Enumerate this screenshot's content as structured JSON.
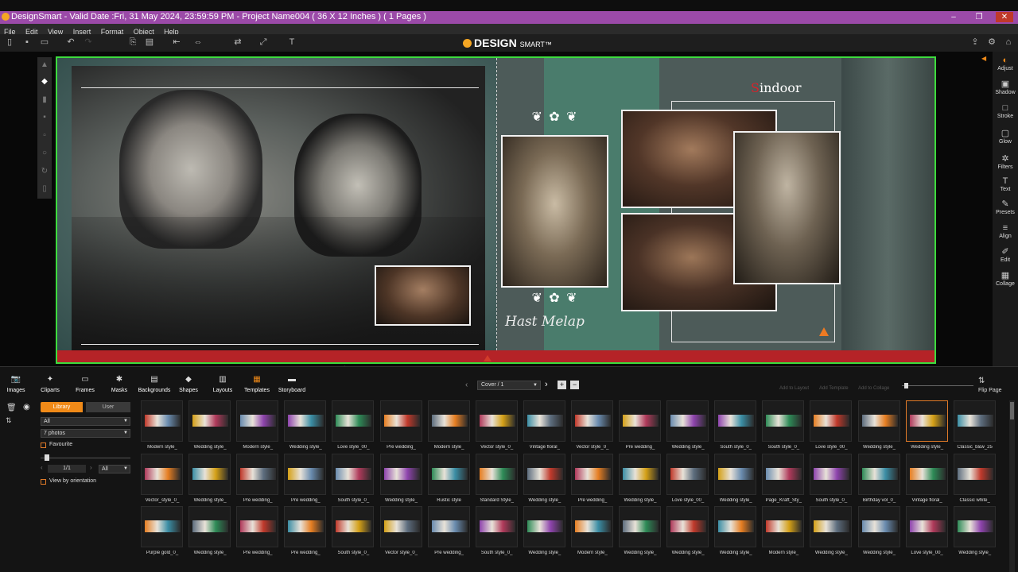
{
  "window": {
    "title": "DesignSmart - Valid Date :Fri, 31 May 2024, 23:59:59 PM - Project Name004 ( 36 X 12 Inches ) ( 1 Pages )",
    "controls": [
      "–",
      "❐",
      "✕"
    ]
  },
  "menu": [
    "File",
    "Edit",
    "View",
    "Insert",
    "Format",
    "Object",
    "Help"
  ],
  "logo": {
    "main": "DESIGN",
    "sub": "SMART™"
  },
  "canvas": {
    "heading": "Sindoor",
    "heading_initial": "S",
    "heading_rest": "indoor",
    "script_text": "Hast Melap",
    "ornament": "❦ ✿ ❦"
  },
  "right_panel": [
    {
      "label": "Adjust",
      "icon": "adjust-icon",
      "glyph": "◐"
    },
    {
      "label": "Shadow",
      "icon": "shadow-icon",
      "glyph": "▣"
    },
    {
      "label": "Stroke",
      "icon": "stroke-icon",
      "glyph": "□"
    },
    {
      "label": "Glow",
      "icon": "glow-icon",
      "glyph": "▢"
    },
    {
      "label": "Filters",
      "icon": "filters-icon",
      "glyph": "✲"
    },
    {
      "label": "Text",
      "icon": "text-icon",
      "glyph": "T"
    },
    {
      "label": "Presets",
      "icon": "presets-icon",
      "glyph": "✎"
    },
    {
      "label": "Align",
      "icon": "align-icon",
      "glyph": "≡"
    },
    {
      "label": "Edit",
      "icon": "edit-icon",
      "glyph": "✐"
    },
    {
      "label": "Collage",
      "icon": "collage-icon",
      "glyph": "▦"
    }
  ],
  "categories": [
    {
      "label": "Images",
      "icon": "images-icon",
      "glyph": "📷"
    },
    {
      "label": "Cliparts",
      "icon": "cliparts-icon",
      "glyph": "✦"
    },
    {
      "label": "Frames",
      "icon": "frames-icon",
      "glyph": "▭"
    },
    {
      "label": "Masks",
      "icon": "masks-icon",
      "glyph": "✱"
    },
    {
      "label": "Backgrounds",
      "icon": "backgrounds-icon",
      "glyph": "▤"
    },
    {
      "label": "Shapes",
      "icon": "shapes-icon",
      "glyph": "◆"
    },
    {
      "label": "Layouts",
      "icon": "layouts-icon",
      "glyph": "▥"
    },
    {
      "label": "Templates",
      "icon": "templates-icon",
      "glyph": "▦"
    },
    {
      "label": "Storyboard",
      "icon": "storyboard-icon",
      "glyph": "▬"
    }
  ],
  "pager": {
    "value": "Cover / 1"
  },
  "faded_actions": [
    "Add to Layout",
    "Add Template",
    "Add to Collage"
  ],
  "flip_page": "Flip Page",
  "library": {
    "tab_library": "Library",
    "tab_user": "User",
    "filter": "All",
    "photos": "7 photos",
    "favourite": "Favourite",
    "page": "1/1",
    "page_filter": "All",
    "view_by_orientation": "View by orientation"
  },
  "templates": [
    [
      "Modern style_",
      "Wedding style_",
      "Modern style_",
      "Wedding style_",
      "Love style_00_",
      "Pre wedding_",
      "Modern style_",
      "Vector style_0_",
      "Vintage floral_",
      "Vector style_0_",
      "Pre wedding_",
      "Wedding style_",
      "South style_0_",
      "South style_0_",
      "Love style_00_",
      "Wedding style_",
      "Wedding style_",
      "Classic_b&w_25"
    ],
    [
      "Vector_style_0_",
      "Wedding style_",
      "Pre wedding_",
      "Pre wedding_",
      "South style_0_",
      "Wedding style_",
      "Rustic style",
      "Standard Style_",
      "Wedding style_",
      "Pre wedding_",
      "Wedding style_",
      "Love style_00_",
      "Wedding style_",
      "Page_Kraft_Sty_",
      "South style_0_",
      "Birthday vol_0_",
      "Vintage floral_",
      "Classic white_"
    ],
    [
      "Purple gold_0_",
      "Wedding style_",
      "Pre wedding_",
      "Pre wedding_",
      "South style_0_",
      "Vector style_0_",
      "Pre wedding_",
      "South style_0_",
      "Wedding style_",
      "Modern style_",
      "Wedding style_",
      "Wedding style_",
      "Wedding style_",
      "Modern style_",
      "Wedding style_",
      "Wedding style_",
      "Love style_00_",
      "Wedding style_"
    ]
  ],
  "colors": {
    "title_bar": "#9b4aa8",
    "accent": "#f08a18",
    "canvas_border": "#3ddc3d",
    "red_strip": "#b52327"
  }
}
